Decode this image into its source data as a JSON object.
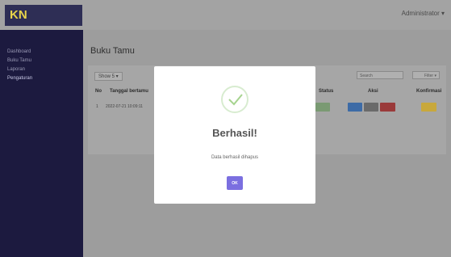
{
  "header": {
    "logo": "KN",
    "user_menu": "Administrator ▾"
  },
  "sidebar": {
    "items": [
      {
        "label": "Dashboard"
      },
      {
        "label": "Buku Tamu"
      },
      {
        "label": "Laporan"
      },
      {
        "label": "Pengaturan"
      }
    ]
  },
  "main": {
    "title": "Buku Tamu",
    "show_entries": "Show 5 ▾",
    "search_placeholder": "Search",
    "filter_label": "Filter ▾",
    "table": {
      "headers": [
        "No",
        "Tanggal bertamu",
        "Status",
        "Aksi",
        "Konfirmasi"
      ],
      "rows": [
        {
          "no": "1",
          "tanggal": "2022-07-21 10:09:11"
        }
      ]
    }
  },
  "modal": {
    "title": "Berhasil!",
    "message": "Data berhasil dihapus",
    "ok_label": "OK"
  },
  "colors": {
    "ok_button": "#7b6fe0",
    "check_stroke": "#a6d48f",
    "btn_green": "#7a9a73",
    "btn_blue": "#3d6ba6",
    "btn_gray": "#6a6a6a",
    "btn_red": "#9a3a3a",
    "btn_yellow": "#c8a83c"
  }
}
